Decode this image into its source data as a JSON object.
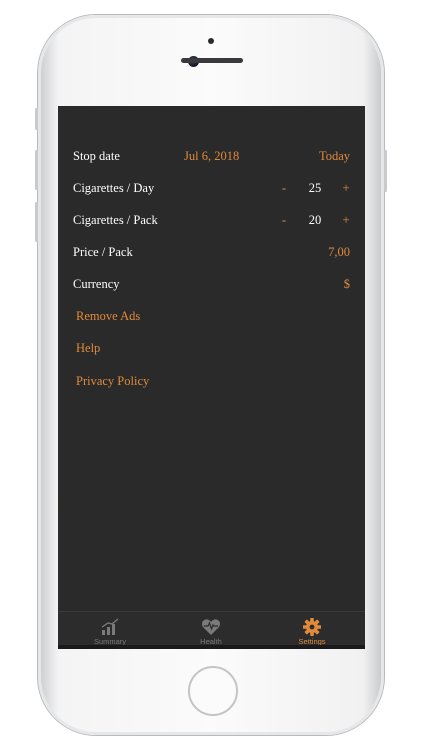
{
  "settings": {
    "stop_date": {
      "label": "Stop date",
      "value": "Jul 6, 2018",
      "action": "Today"
    },
    "cigs_day": {
      "label": "Cigarettes / Day",
      "minus": "-",
      "value": "25",
      "plus": "+"
    },
    "cigs_pack": {
      "label": "Cigarettes / Pack",
      "minus": "-",
      "value": "20",
      "plus": "+"
    },
    "price_pack": {
      "label": "Price / Pack",
      "value": "7,00"
    },
    "currency": {
      "label": "Currency",
      "value": "$"
    }
  },
  "links": {
    "remove_ads": "Remove Ads",
    "help": "Help",
    "privacy": "Privacy Policy"
  },
  "tabs": {
    "summary": "Summary",
    "health": "Health",
    "settings": "Settings"
  },
  "icons": {
    "summary": "bar-chart-icon",
    "health": "heart-pulse-icon",
    "settings": "gear-icon"
  },
  "colors": {
    "accent": "#e08a3c",
    "background": "#2a2a2a",
    "text": "#ffffff",
    "inactive_tab": "#7a7a7a"
  }
}
